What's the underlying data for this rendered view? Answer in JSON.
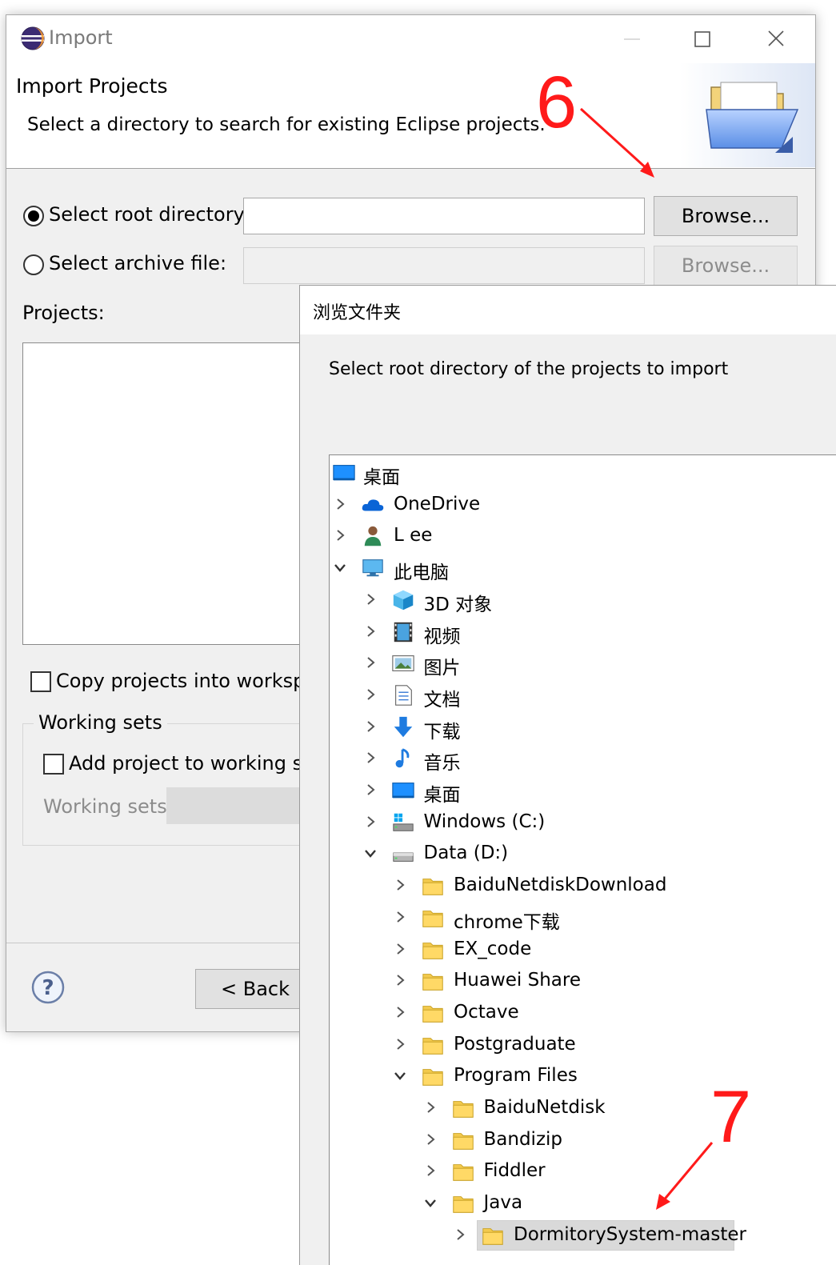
{
  "window": {
    "title": "Import",
    "banner_title": "Import Projects",
    "banner_desc": "Select a directory to search for existing Eclipse projects."
  },
  "form": {
    "root_dir_label": "Select root directory:",
    "root_dir_value": "",
    "archive_label": "Select archive file:",
    "archive_value": "",
    "browse_label": "Browse...",
    "browse2_label": "Browse...",
    "projects_label": "Projects:",
    "copy_label": "Copy projects into workspace",
    "working_sets_group": "Working sets",
    "add_ws_label": "Add project to working sets",
    "ws_label": "Working sets:"
  },
  "footer": {
    "back_label": "< Back"
  },
  "annotations": {
    "step6": "6",
    "step7": "7",
    "color": "#ff1a1a"
  },
  "dialog": {
    "title": "浏览文件夹",
    "prompt": "Select root directory of the projects to import",
    "tree": [
      {
        "label": "桌面",
        "icon": "desktop-icon",
        "level": 0,
        "chevron": "none"
      },
      {
        "label": "OneDrive",
        "icon": "onedrive-cloud-icon",
        "level": 1,
        "chevron": "right"
      },
      {
        "label": "L ee",
        "icon": "user-icon",
        "level": 1,
        "chevron": "right"
      },
      {
        "label": "此电脑",
        "icon": "computer-icon",
        "level": 1,
        "chevron": "down"
      },
      {
        "label": "3D 对象",
        "icon": "3d-objects-icon",
        "level": 2,
        "chevron": "right"
      },
      {
        "label": "视频",
        "icon": "video-icon",
        "level": 2,
        "chevron": "right"
      },
      {
        "label": "图片",
        "icon": "pictures-icon",
        "level": 2,
        "chevron": "right"
      },
      {
        "label": "文档",
        "icon": "documents-icon",
        "level": 2,
        "chevron": "right"
      },
      {
        "label": "下载",
        "icon": "downloads-icon",
        "level": 2,
        "chevron": "right"
      },
      {
        "label": "音乐",
        "icon": "music-icon",
        "level": 2,
        "chevron": "right"
      },
      {
        "label": "桌面",
        "icon": "desktop-icon",
        "level": 2,
        "chevron": "right"
      },
      {
        "label": "Windows (C:)",
        "icon": "windows-drive-icon",
        "level": 2,
        "chevron": "right"
      },
      {
        "label": "Data (D:)",
        "icon": "drive-icon",
        "level": 2,
        "chevron": "down"
      },
      {
        "label": "BaiduNetdiskDownload",
        "icon": "folder-icon",
        "level": 3,
        "chevron": "right"
      },
      {
        "label": "chrome下载",
        "icon": "folder-icon",
        "level": 3,
        "chevron": "right"
      },
      {
        "label": "EX_code",
        "icon": "folder-icon",
        "level": 3,
        "chevron": "right"
      },
      {
        "label": "Huawei Share",
        "icon": "folder-icon",
        "level": 3,
        "chevron": "right"
      },
      {
        "label": "Octave",
        "icon": "folder-icon",
        "level": 3,
        "chevron": "right"
      },
      {
        "label": "Postgraduate",
        "icon": "folder-icon",
        "level": 3,
        "chevron": "right"
      },
      {
        "label": "Program Files",
        "icon": "folder-icon",
        "level": 3,
        "chevron": "down"
      },
      {
        "label": "BaiduNetdisk",
        "icon": "folder-icon",
        "level": 4,
        "chevron": "right"
      },
      {
        "label": "Bandizip",
        "icon": "folder-icon",
        "level": 4,
        "chevron": "right"
      },
      {
        "label": "Fiddler",
        "icon": "folder-icon",
        "level": 4,
        "chevron": "right"
      },
      {
        "label": "Java",
        "icon": "folder-icon",
        "level": 4,
        "chevron": "down"
      },
      {
        "label": "DormitorySystem-master",
        "icon": "folder-icon",
        "level": 5,
        "chevron": "right",
        "selected": true
      }
    ]
  }
}
